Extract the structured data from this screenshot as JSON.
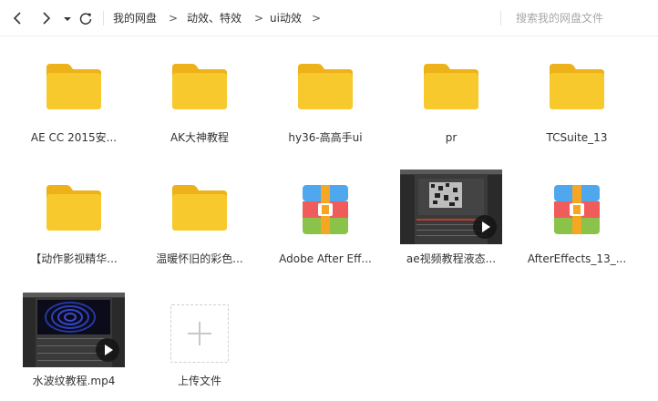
{
  "toolbar": {
    "breadcrumbs": [
      "我的网盘",
      "动效、特效",
      "ui动效"
    ],
    "separator": ">",
    "search_placeholder": "搜索我的网盘文件"
  },
  "files": [
    {
      "name": "AE CC  2015安...",
      "type": "folder"
    },
    {
      "name": "AK大神教程",
      "type": "folder"
    },
    {
      "name": "hy36-高高手ui",
      "type": "folder"
    },
    {
      "name": "pr",
      "type": "folder"
    },
    {
      "name": "TCSuite_13",
      "type": "folder"
    },
    {
      "name": "【动作影视精华...",
      "type": "folder"
    },
    {
      "name": "温暖怀旧的彩色...",
      "type": "folder"
    },
    {
      "name": "Adobe After Eff...",
      "type": "archive"
    },
    {
      "name": "ae视频教程液态...",
      "type": "video"
    },
    {
      "name": "AfterEffects_13_...",
      "type": "archive"
    },
    {
      "name": "水波纹教程.mp4",
      "type": "video"
    }
  ],
  "upload": {
    "label": "上传文件"
  },
  "colors": {
    "folder": "#F8C92C",
    "folder_tab": "#EDB21A",
    "archive_top": "#4FA8EE",
    "archive_mid": "#F05B5B",
    "archive_bottom": "#8BC34A",
    "archive_strap": "#F5A623"
  }
}
